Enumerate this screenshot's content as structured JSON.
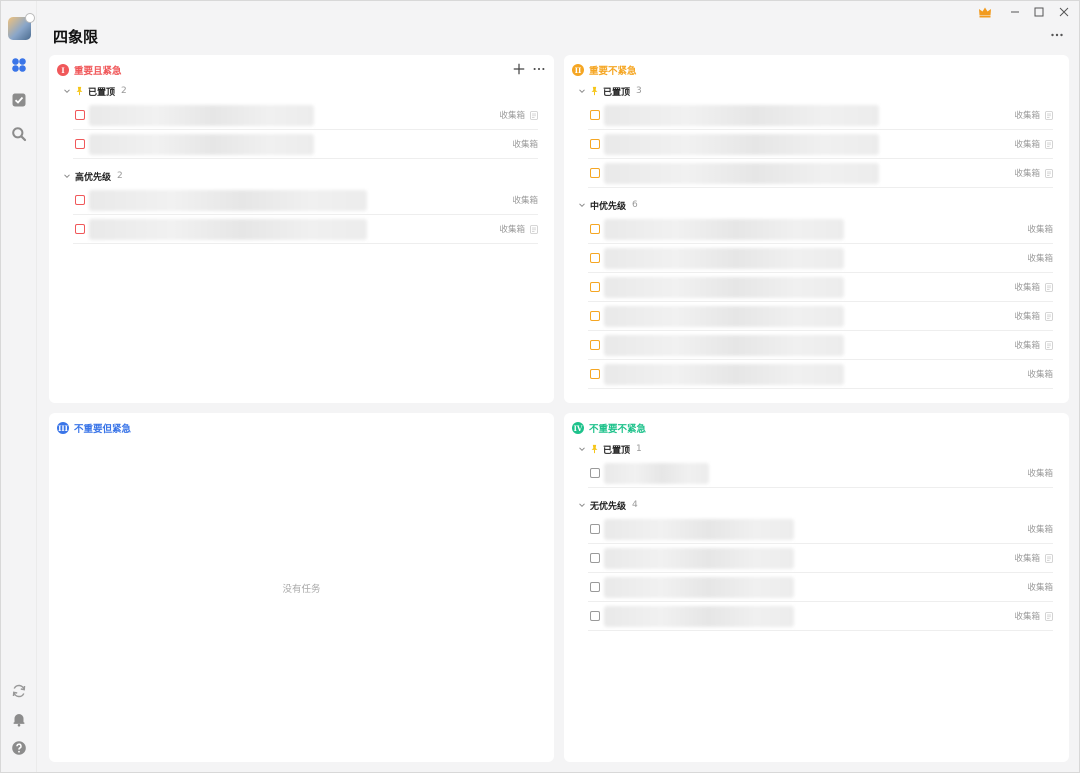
{
  "app": {
    "page_title": "四象限"
  },
  "colors": {
    "red": "#f0585a",
    "orange": "#f5a623",
    "blue": "#3a75e8",
    "green": "#1ec28b"
  },
  "sidebar": {
    "icons": [
      "avatar",
      "quadrant-icon",
      "checkbox-icon",
      "search-icon",
      "sync-icon",
      "bell-icon",
      "help-icon"
    ]
  },
  "quadrants": {
    "q1": {
      "badge": "I",
      "title": "重要且紧急",
      "groups": [
        {
          "label": "已置顶",
          "count": "2",
          "tasks": [
            {
              "project": "收集箱",
              "note": true
            },
            {
              "project": "收集箱",
              "note": false
            }
          ]
        },
        {
          "label": "高优先级",
          "count": "2",
          "tasks": [
            {
              "project": "收集箱",
              "note": false
            },
            {
              "project": "收集箱",
              "note": true
            }
          ]
        }
      ]
    },
    "q2": {
      "badge": "II",
      "title": "重要不紧急",
      "groups": [
        {
          "label": "已置顶",
          "count": "3",
          "tasks": [
            {
              "project": "收集箱",
              "note": true
            },
            {
              "project": "收集箱",
              "note": true
            },
            {
              "project": "收集箱",
              "note": true
            }
          ]
        },
        {
          "label": "中优先级",
          "count": "6",
          "tasks": [
            {
              "project": "收集箱",
              "note": false
            },
            {
              "project": "收集箱",
              "note": false
            },
            {
              "project": "收集箱",
              "note": true
            },
            {
              "project": "收集箱",
              "note": true
            },
            {
              "project": "收集箱",
              "note": true
            },
            {
              "project": "收集箱",
              "note": false
            }
          ]
        }
      ]
    },
    "q3": {
      "badge": "III",
      "title": "不重要但紧急",
      "empty_text": "没有任务"
    },
    "q4": {
      "badge": "IV",
      "title": "不重要不紧急",
      "groups": [
        {
          "label": "已置顶",
          "count": "1",
          "tasks": [
            {
              "project": "收集箱",
              "note": false
            }
          ]
        },
        {
          "label": "无优先级",
          "count": "4",
          "tasks": [
            {
              "project": "收集箱",
              "note": false
            },
            {
              "project": "收集箱",
              "note": true
            },
            {
              "project": "收集箱",
              "note": false
            },
            {
              "project": "收集箱",
              "note": true
            }
          ]
        }
      ]
    }
  }
}
